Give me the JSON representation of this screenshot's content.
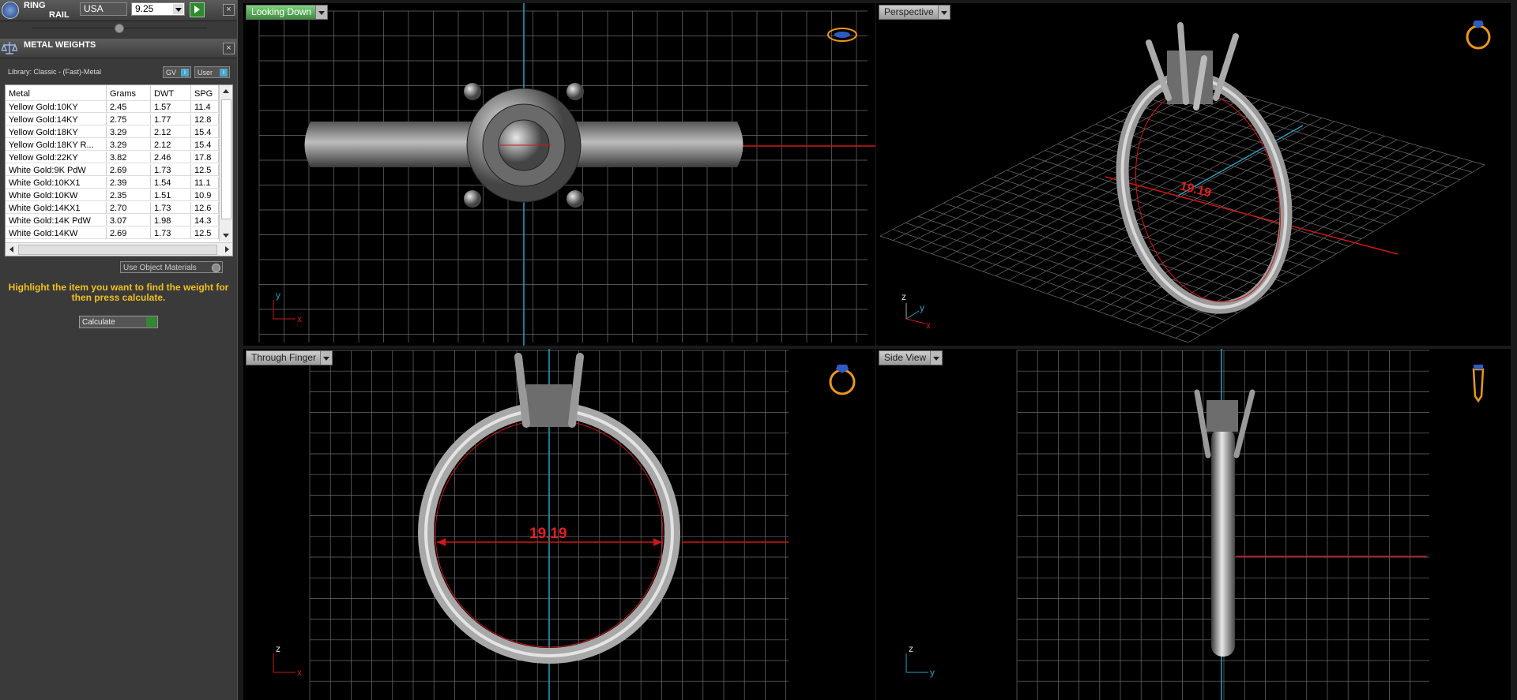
{
  "ring_rail": {
    "title_line1": "RING",
    "title_line2": "RAIL",
    "region": "USA",
    "size": "9.25"
  },
  "metal_weights": {
    "title": "METAL WEIGHTS",
    "library": "Library: Classic - (Fast)-Metal",
    "gv_label": "GV",
    "user_label": "User",
    "columns": [
      "Metal",
      "Grams",
      "DWT",
      "SPG"
    ],
    "rows": [
      [
        "Yellow Gold:10KY",
        "2.45",
        "1.57",
        "11.4"
      ],
      [
        "Yellow Gold:14KY",
        "2.75",
        "1.77",
        "12.8"
      ],
      [
        "Yellow Gold:18KY",
        "3.29",
        "2.12",
        "15.4"
      ],
      [
        "Yellow Gold:18KY R...",
        "3.29",
        "2.12",
        "15.4"
      ],
      [
        "Yellow Gold:22KY",
        "3.82",
        "2.46",
        "17.8"
      ],
      [
        "White Gold:9K PdW",
        "2.69",
        "1.73",
        "12.5"
      ],
      [
        "White Gold:10KX1",
        "2.39",
        "1.54",
        "11.1"
      ],
      [
        "White Gold:10KW",
        "2.35",
        "1.51",
        "10.9"
      ],
      [
        "White Gold:14KX1",
        "2.70",
        "1.73",
        "12.6"
      ],
      [
        "White Gold:14K PdW",
        "3.07",
        "1.98",
        "14.3"
      ],
      [
        "White Gold:14KW",
        "2.69",
        "1.73",
        "12.5"
      ]
    ],
    "use_object_materials": "Use Object Materials",
    "hint": "Highlight the item you want to find the weight for then press calculate.",
    "calculate_label": "Calculate"
  },
  "viewports": {
    "top_left": {
      "title": "Looking Down",
      "axis_a": "y",
      "axis_b": "x"
    },
    "top_right": {
      "title": "Perspective",
      "dimension": "19.19",
      "axis_a": "z",
      "axis_b": "y",
      "axis_c": "x"
    },
    "bottom_left": {
      "title": "Through Finger",
      "dimension": "19.19",
      "axis_a": "z",
      "axis_b": "x"
    },
    "bottom_right": {
      "title": "Side View",
      "axis_a": "z",
      "axis_b": "y"
    }
  },
  "colors": {
    "grid": "#6e6e6e",
    "axis_red": "#d01818",
    "axis_cyan": "#2aa0c0",
    "hint_text": "#f0c020",
    "ring_gray": "#8a8a8a",
    "icon_orange": "#e8961e"
  }
}
